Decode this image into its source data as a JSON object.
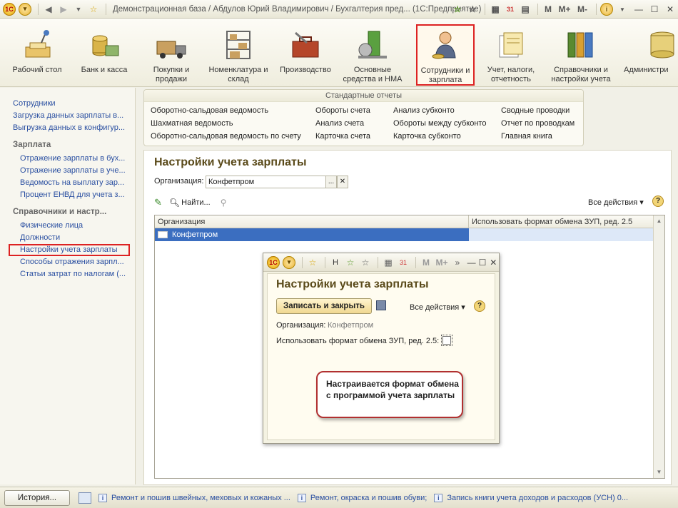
{
  "window": {
    "title": "Демонстрационная база / Абдулов Юрий Владимирович / Бухгалтерия пред...  (1С:Предприятие)",
    "right_buttons": [
      "M",
      "M+",
      "M-"
    ],
    "info_icon": "i"
  },
  "ribbon": {
    "items": [
      {
        "label": "Рабочий стол",
        "icon": "desk-lamp-icon"
      },
      {
        "label": "Банк и касса",
        "icon": "coins-icon"
      },
      {
        "label": "Покупки и продажи",
        "icon": "truck-icon"
      },
      {
        "label": "Номенклатура и склад",
        "icon": "shelves-icon"
      },
      {
        "label": "Производство",
        "icon": "toolbox-icon"
      },
      {
        "label": "Основные средства и НМА",
        "icon": "machine-icon"
      },
      {
        "label": "Сотрудники и зарплата",
        "icon": "employee-icon",
        "active": true
      },
      {
        "label": "Учет, налоги, отчетность",
        "icon": "documents-icon"
      },
      {
        "label": "Справочники и настройки учета",
        "icon": "binders-icon"
      },
      {
        "label": "Администри",
        "icon": "admin-icon"
      }
    ]
  },
  "leftnav": {
    "top_links": [
      "Сотрудники",
      "Загрузка данных зарплаты в...",
      "Выгрузка данных в конфигур..."
    ],
    "section1_title": "Зарплата",
    "section1_links": [
      "Отражение зарплаты в бух...",
      "Отражение зарплаты в уче...",
      "Ведомость на выплату зар...",
      "Процент ЕНВД для учета з..."
    ],
    "section2_title": "Справочники и настр...",
    "section2_links": [
      "Физические лица",
      "Должности",
      "Настройки учета зарплаты",
      "Способы отражения зарпл...",
      "Статьи затрат по налогам (..."
    ]
  },
  "reports": {
    "title": "Стандартные отчеты",
    "col1": [
      "Оборотно-сальдовая ведомость",
      "Шахматная ведомость",
      "Оборотно-сальдовая ведомость по счету"
    ],
    "col2": [
      "Обороты счета",
      "Анализ счета",
      "Карточка счета"
    ],
    "col3": [
      "Анализ субконто",
      "Обороты между субконто",
      "Карточка субконто"
    ],
    "col4": [
      "Сводные проводки",
      "Отчет по проводкам",
      "Главная книга"
    ]
  },
  "mainform": {
    "title": "Настройки учета зарплаты",
    "org_label": "Организация:",
    "org_value": "Конфетпром",
    "find_label": "Найти...",
    "all_actions": "Все действия",
    "columns": [
      "Организация",
      "Использовать формат обмена ЗУП, ред. 2.5"
    ],
    "rows": [
      {
        "org": "Конфетпром",
        "use_format": ""
      }
    ]
  },
  "dialog": {
    "title": "Настройки учета зарплаты",
    "save_close": "Записать и закрыть",
    "all_actions": "Все действия",
    "org_label": "Организация:",
    "org_value": "Конфетпром",
    "format_label": "Использовать формат обмена ЗУП, ред. 2.5:",
    "format_checked": false,
    "toolbar_letters": [
      "H",
      "M",
      "M+"
    ],
    "callout": "Настраивается формат обмена с программой учета зарплаты"
  },
  "statusbar": {
    "history": "История...",
    "items": [
      "Ремонт и пошив швейных, меховых и кожаных ...",
      "Ремонт, окраска и пошив обуви;",
      "Запись книги учета доходов и расходов (УСН) 0..."
    ]
  }
}
